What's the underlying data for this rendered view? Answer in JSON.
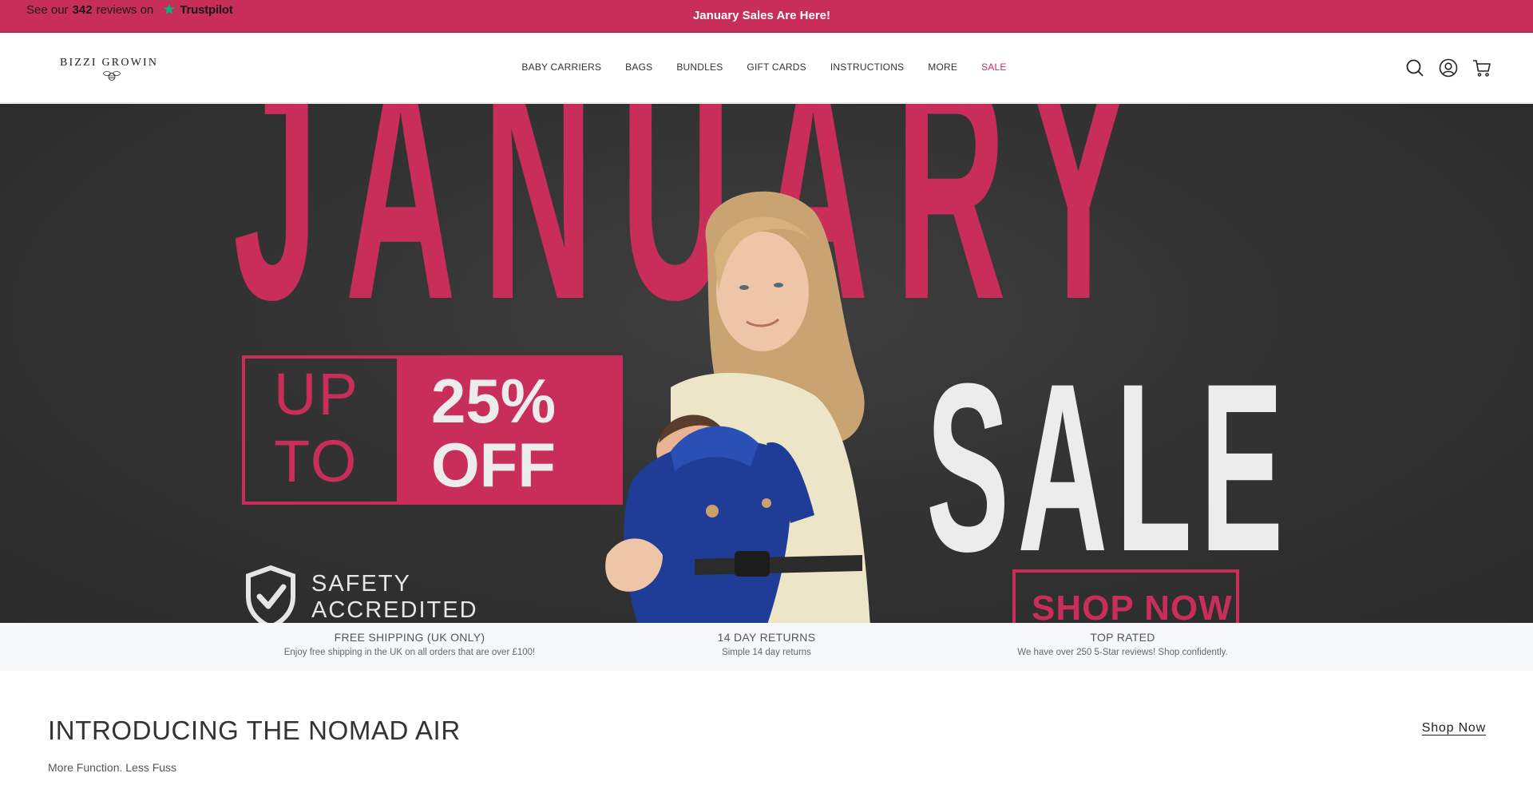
{
  "announcement": {
    "trustpilot_prefix": "See our",
    "trustpilot_count": "342",
    "trustpilot_suffix": "reviews on",
    "trustpilot_brand": "Trustpilot",
    "message": "January Sales Are Here!",
    "background_color": "#c92d5a"
  },
  "header": {
    "logo_text": "BIZZI GROWIN",
    "nav": [
      {
        "label": "BABY CARRIERS"
      },
      {
        "label": "BAGS"
      },
      {
        "label": "BUNDLES"
      },
      {
        "label": "GIFT CARDS"
      },
      {
        "label": "INSTRUCTIONS"
      },
      {
        "label": "MORE"
      },
      {
        "label": "SALE"
      }
    ],
    "icons": [
      "search-icon",
      "account-icon",
      "cart-icon"
    ]
  },
  "hero": {
    "headline": "JANUARY",
    "promo_line1": "UP",
    "promo_line2": "TO",
    "promo_value": "25%",
    "promo_off": "OFF",
    "sale_word": "SALE",
    "cta": "SHOP NOW",
    "badge_line1": "SAFETY",
    "badge_line2": "ACCREDITED",
    "accent_color": "#c92d5a"
  },
  "features": [
    {
      "title": "FREE SHIPPING (UK ONLY)",
      "subtitle": "Enjoy free shipping in the UK on all orders that are over £100!"
    },
    {
      "title": "14 DAY RETURNS",
      "subtitle": "Simple 14 day returns"
    },
    {
      "title": "TOP RATED",
      "subtitle": "We have over 250 5-Star reviews! Shop confidently."
    }
  ],
  "intro": {
    "title": "INTRODUCING THE NOMAD AIR",
    "subtitle": "More Function. Less Fuss",
    "link": "Shop Now"
  }
}
